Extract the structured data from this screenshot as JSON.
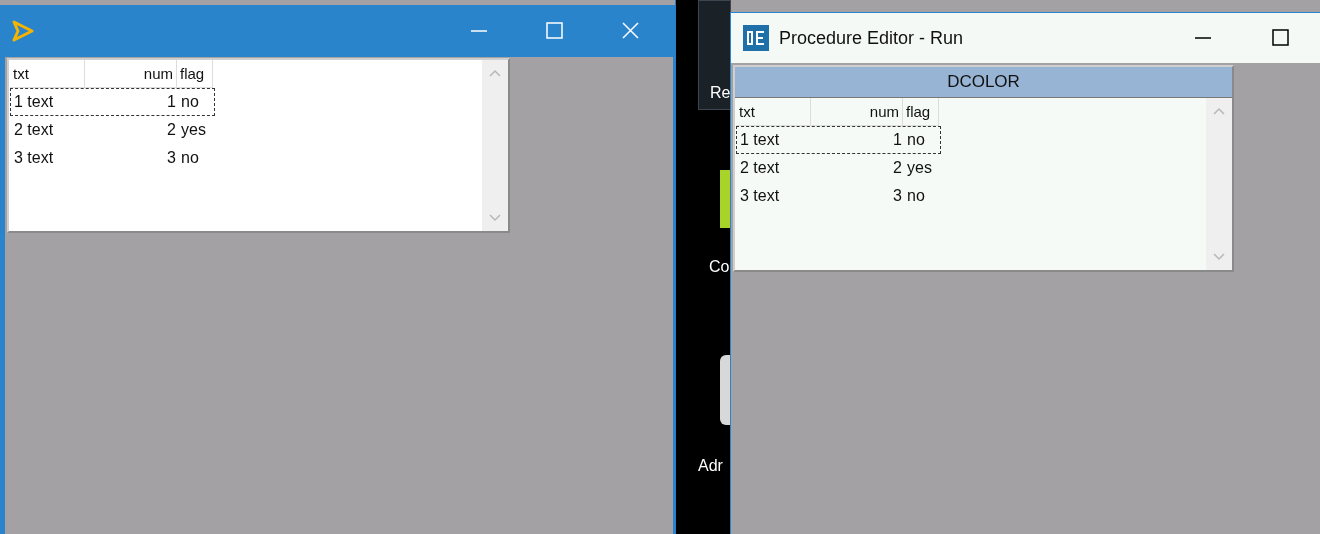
{
  "desktop": {
    "icons": [
      {
        "label": "Re",
        "kind": "tile"
      },
      {
        "label": "Co",
        "kind": "green"
      },
      {
        "label": "Adr",
        "kind": "person"
      }
    ]
  },
  "windows": [
    {
      "active": true,
      "browse": {
        "columns": [
          {
            "label": "txt",
            "kind": "text"
          },
          {
            "label": "num",
            "kind": "number"
          },
          {
            "label": "flag",
            "kind": "text"
          }
        ],
        "rows": [
          {
            "cells": [
              "1 text",
              "1",
              "no"
            ],
            "selected": true
          },
          {
            "cells": [
              "2 text",
              "2",
              "yes"
            ],
            "selected": false
          },
          {
            "cells": [
              "3 text",
              "3",
              "no"
            ],
            "selected": false
          }
        ]
      }
    },
    {
      "title": "Procedure Editor - Run",
      "active": false,
      "browse": {
        "title": "DCOLOR",
        "columns": [
          {
            "label": "txt",
            "kind": "text"
          },
          {
            "label": "num",
            "kind": "number"
          },
          {
            "label": "flag",
            "kind": "text"
          }
        ],
        "rows": [
          {
            "cells": [
              "1 text",
              "1",
              "no"
            ],
            "selected": true
          },
          {
            "cells": [
              "2 text",
              "2",
              "yes"
            ],
            "selected": false
          },
          {
            "cells": [
              "3 text",
              "3",
              "no"
            ],
            "selected": false
          }
        ]
      }
    }
  ]
}
